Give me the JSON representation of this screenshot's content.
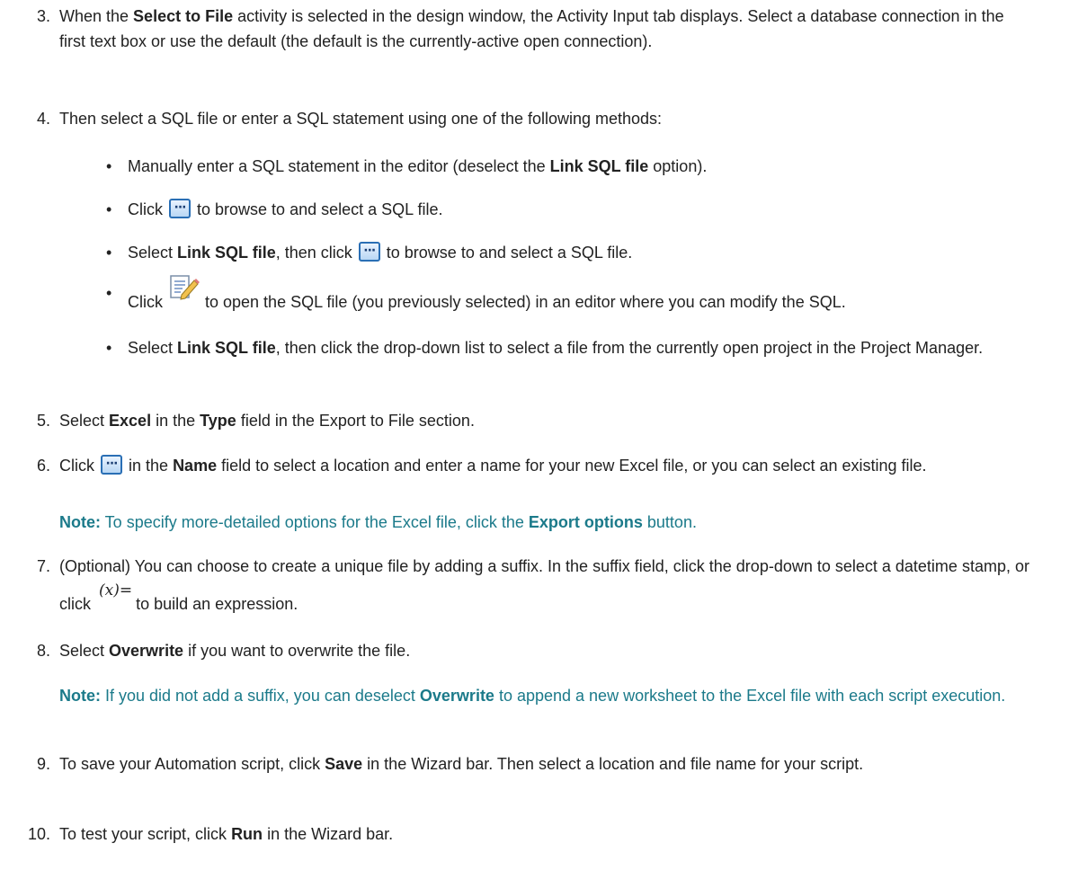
{
  "steps": [
    {
      "num": "3.",
      "parts": [
        "When the ",
        "Select to File",
        " activity is selected in the design window, the Activity Input tab displays. Select a database connection in the first text box or use the default (the default is the currently-active open connection)."
      ]
    },
    {
      "num": "4.",
      "text": "Then select a SQL file or enter a SQL statement using one of the following methods:",
      "bullets": [
        {
          "parts": [
            "Manually enter a SQL statement in the editor (deselect the ",
            "Link SQL file",
            " option)."
          ]
        },
        {
          "parts": [
            "Click ",
            "to browse to and select a SQL file."
          ],
          "icon": "browse-ellipsis-icon"
        },
        {
          "parts": [
            "Select ",
            "Link SQL file",
            ", then click ",
            "to browse to and select a SQL file."
          ],
          "icon": "browse-ellipsis-icon"
        },
        {
          "parts": [
            "Click ",
            "to open the SQL file (you previously selected) in an editor where you can modify the SQL."
          ],
          "icon": "edit-file-icon"
        },
        {
          "parts": [
            "Select ",
            "Link SQL file",
            ", then click the drop-down list to select a file from the currently open project in the Project Manager."
          ]
        }
      ]
    },
    {
      "num": "5.",
      "parts": [
        "Select ",
        "Excel",
        " in the ",
        "Type",
        " field in the Export to File section."
      ]
    },
    {
      "num": "6.",
      "parts": [
        "Click ",
        "in the ",
        "Name",
        " field to select a location and enter a name for your new Excel file, or you can select an existing file."
      ],
      "icon": "browse-ellipsis-icon",
      "note": {
        "label": "Note:",
        "parts": [
          " To specify more-detailed options for the Excel file, click the ",
          "Export options",
          " button."
        ]
      }
    },
    {
      "num": "7.",
      "parts": [
        "(Optional) You can choose to create a unique file by adding a suffix. In the suffix field, click the drop-down to select a datetime stamp, or click ",
        "to build an expression."
      ],
      "icon": "expression-builder-icon",
      "icon_text": "(x)="
    },
    {
      "num": "8.",
      "parts": [
        "Select ",
        "Overwrite",
        " if you want to overwrite the file."
      ],
      "note": {
        "label": "Note:",
        "parts": [
          " If you did not add a suffix, you can deselect ",
          "Overwrite",
          " to append a new worksheet to the Excel file with each script execution."
        ]
      }
    },
    {
      "num": "9.",
      "parts": [
        "To save your Automation script, click ",
        "Save",
        " in the Wizard bar. Then select a location and file name for your script."
      ]
    },
    {
      "num": "10.",
      "parts": [
        "To test your script, click ",
        "Run",
        " in the Wizard bar."
      ]
    }
  ],
  "colors": {
    "text": "#222222",
    "note": "#1b7a8a",
    "icon_blue": "#2a6fb5"
  }
}
